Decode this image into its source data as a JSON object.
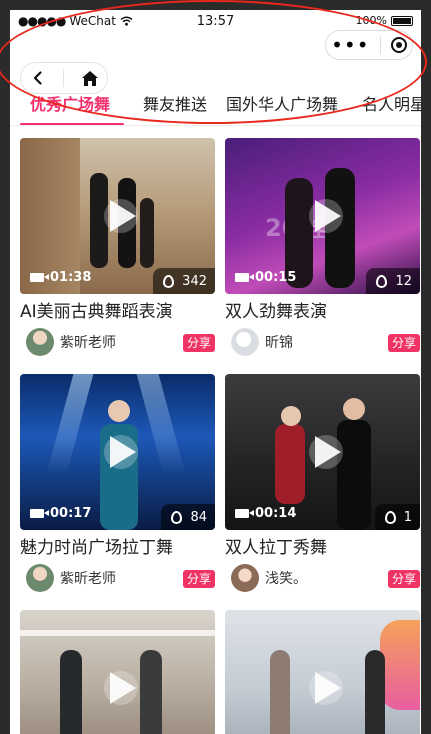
{
  "status_bar": {
    "carrier": "WeChat",
    "time": "13:57",
    "battery": "100%"
  },
  "capsule": {
    "more_icon": "more-dots-icon",
    "close_icon": "target-icon"
  },
  "nav": {
    "back_icon": "chevron-left-icon",
    "home_icon": "home-icon"
  },
  "tabs": [
    {
      "label": "优秀广场舞",
      "active": true
    },
    {
      "label": "舞友推送",
      "active": false
    },
    {
      "label": "国外华人广场舞",
      "active": false
    },
    {
      "label": "名人明星",
      "active": false
    }
  ],
  "videos": [
    {
      "title": "AI美丽古典舞蹈表演",
      "duration": "01:38",
      "hot": "342",
      "author": "紫昕老师",
      "share": "分享"
    },
    {
      "title": "双人劲舞表演",
      "duration": "00:15",
      "hot": "12",
      "author": "昕锦",
      "share": "分享"
    },
    {
      "title": "魅力时尚广场拉丁舞",
      "duration": "00:17",
      "hot": "84",
      "author": "紫昕老师",
      "share": "分享"
    },
    {
      "title": "双人拉丁秀舞",
      "duration": "00:14",
      "hot": "1",
      "author": "浅笑。",
      "share": "分享"
    },
    {
      "title": "",
      "duration": "",
      "hot": "",
      "author": "",
      "share": ""
    },
    {
      "title": "",
      "duration": "",
      "hot": "",
      "author": "",
      "share": ""
    }
  ],
  "colors": {
    "accent": "#f0336f",
    "share_bg": "#ef3465",
    "annotation": "#e8281c"
  }
}
